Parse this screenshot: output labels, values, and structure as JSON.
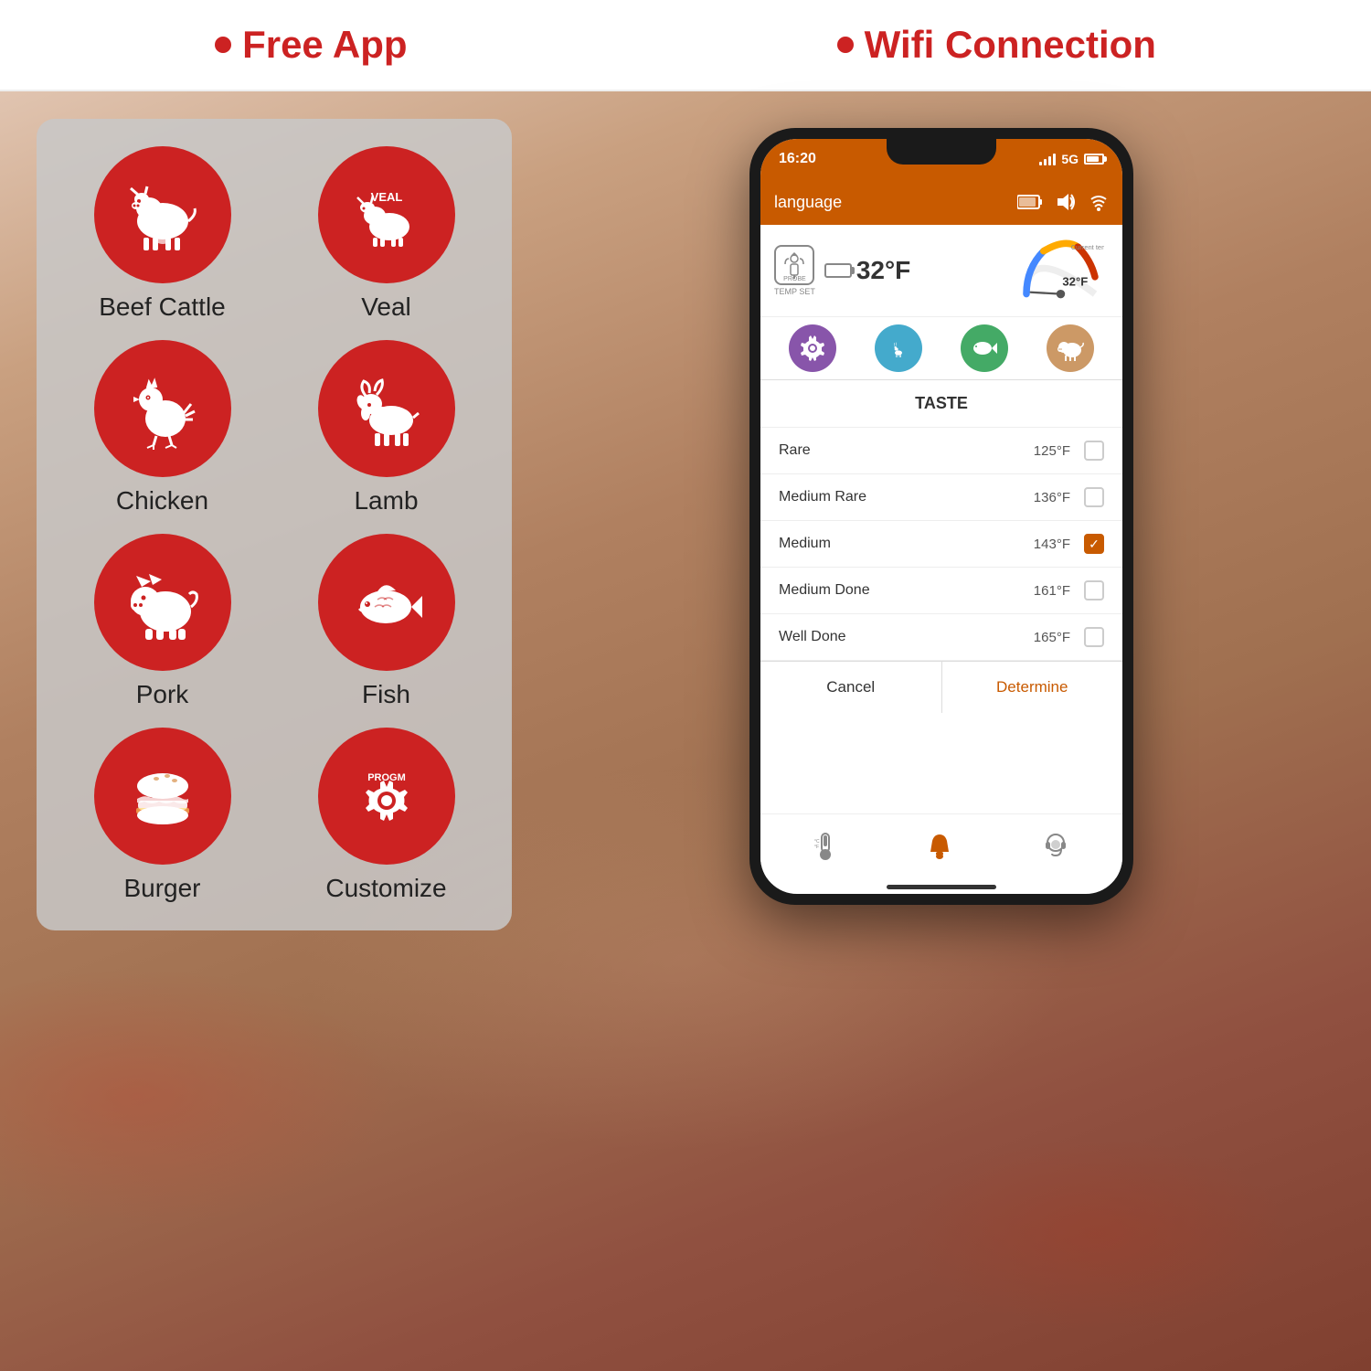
{
  "header": {
    "free_app_label": "Free App",
    "wifi_label": "Wifi Connection",
    "bullet_color": "#cc2222"
  },
  "app_panel": {
    "meat_items": [
      {
        "id": "beef-cattle",
        "label": "Beef Cattle",
        "emoji": "🐄",
        "color": "#cc2222"
      },
      {
        "id": "veal",
        "label": "Veal",
        "emoji": "🐮",
        "color": "#cc2222",
        "extra": "VEAL"
      },
      {
        "id": "chicken",
        "label": "Chicken",
        "emoji": "🐔",
        "color": "#cc2222"
      },
      {
        "id": "lamb",
        "label": "Lamb",
        "emoji": "🐐",
        "color": "#cc2222"
      },
      {
        "id": "pork",
        "label": "Pork",
        "emoji": "🐷",
        "color": "#cc2222"
      },
      {
        "id": "fish",
        "label": "Fish",
        "emoji": "🐟",
        "color": "#cc2222"
      },
      {
        "id": "burger",
        "label": "Burger",
        "emoji": "🍔",
        "color": "#cc2222"
      },
      {
        "id": "customize",
        "label": "Customize",
        "emoji": "⚙️",
        "color": "#cc2222",
        "extra": "PROGM"
      }
    ]
  },
  "phone": {
    "status_bar": {
      "time": "16:20",
      "network": "5G"
    },
    "header": {
      "title": "language"
    },
    "probe": {
      "label": "PROBE",
      "sub_label": "TEMP SET",
      "current_temp": "32°F",
      "gauge_label": "Current temp",
      "gauge_value": "32°F"
    },
    "animal_icons": [
      {
        "id": "progm",
        "color": "#8855aa",
        "emoji": "⚙",
        "label": "PROGM"
      },
      {
        "id": "goat",
        "color": "#44aacc",
        "emoji": "🐐"
      },
      {
        "id": "fish",
        "color": "#44aa66",
        "emoji": "🐟"
      },
      {
        "id": "pig",
        "color": "#cc9966",
        "emoji": "🐷"
      }
    ],
    "taste_dialog": {
      "title": "TASTE",
      "options": [
        {
          "id": "rare",
          "name": "Rare",
          "temp": "125°F",
          "checked": false
        },
        {
          "id": "medium-rare",
          "name": "Medium Rare",
          "temp": "136°F",
          "checked": false
        },
        {
          "id": "medium",
          "name": "Medium",
          "temp": "143°F",
          "checked": true
        },
        {
          "id": "medium-done",
          "name": "Medium Done",
          "temp": "161°F",
          "checked": false
        },
        {
          "id": "well-done",
          "name": "Well Done",
          "temp": "165°F",
          "checked": false
        }
      ],
      "cancel_label": "Cancel",
      "determine_label": "Determine"
    },
    "bottom_bar": {
      "items": [
        {
          "id": "thermometer",
          "icon": "🌡",
          "active": false
        },
        {
          "id": "bell",
          "icon": "🔔",
          "active": true
        },
        {
          "id": "support",
          "icon": "🎧",
          "active": false
        }
      ]
    }
  }
}
